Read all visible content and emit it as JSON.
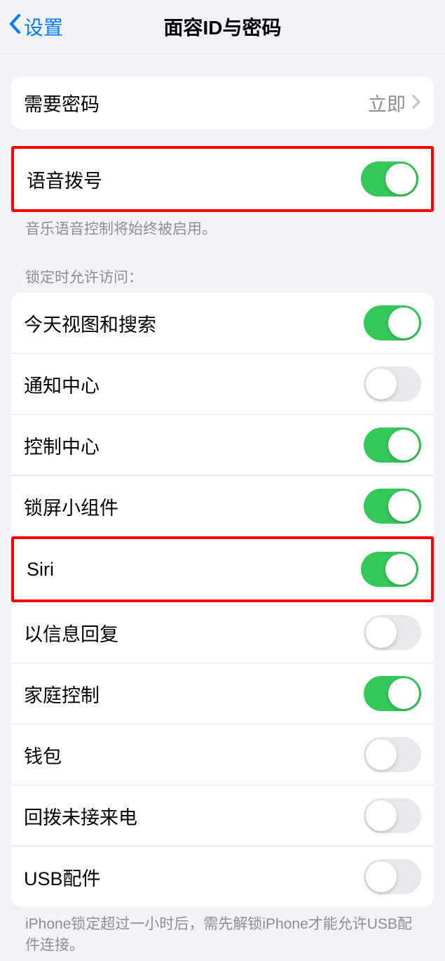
{
  "header": {
    "back_label": "设置",
    "title": "面容ID与密码"
  },
  "group1": {
    "require_passcode": {
      "label": "需要密码",
      "value": "立即"
    }
  },
  "group2": {
    "voice_dial": {
      "label": "语音拨号",
      "on": true
    },
    "footer": "音乐语音控制将始终被启用。"
  },
  "section3": {
    "header": "锁定时允许访问：",
    "items": [
      {
        "label": "今天视图和搜索",
        "on": true
      },
      {
        "label": "通知中心",
        "on": false
      },
      {
        "label": "控制中心",
        "on": true
      },
      {
        "label": "锁屏小组件",
        "on": true
      },
      {
        "label": "Siri",
        "on": true
      },
      {
        "label": "以信息回复",
        "on": false
      },
      {
        "label": "家庭控制",
        "on": true
      },
      {
        "label": "钱包",
        "on": false
      },
      {
        "label": "回拨未接来电",
        "on": false
      },
      {
        "label": "USB配件",
        "on": false
      }
    ],
    "footer": "iPhone锁定超过一小时后，需先解锁iPhone才能允许USB配件连接。"
  }
}
